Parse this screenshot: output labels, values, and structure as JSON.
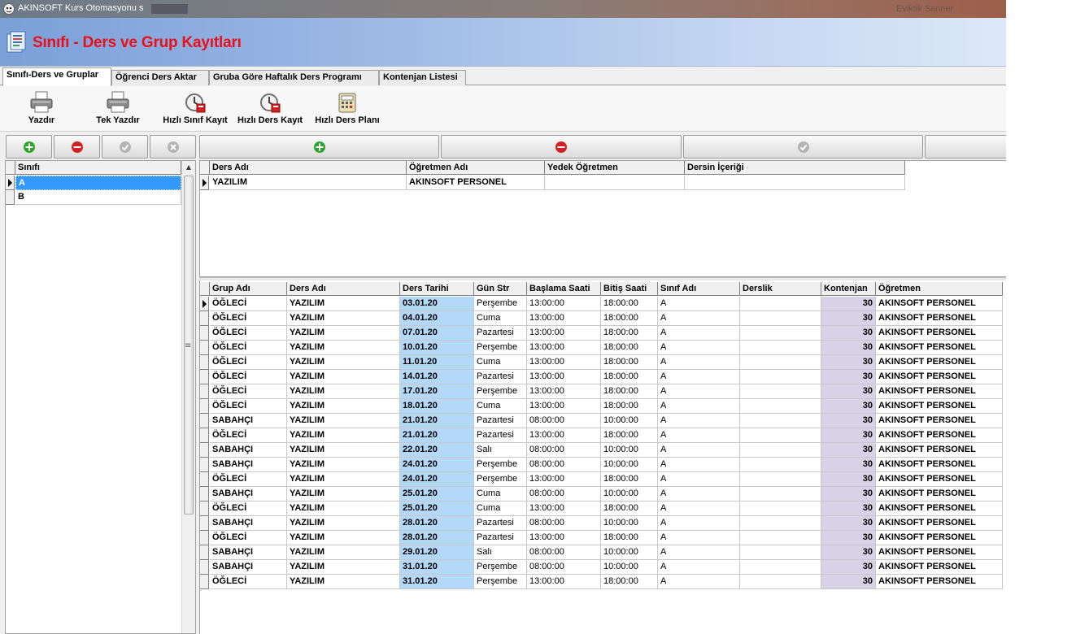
{
  "window": {
    "title": "AKINSOFT Kurs Otomasyonu s",
    "right_text": "Eviktik Sanner"
  },
  "header": {
    "title": "Sınıfı - Ders ve Grup Kayıtları"
  },
  "tabs": [
    {
      "label": "Sınıfı-Ders ve Gruplar",
      "active": true
    },
    {
      "label": "Öğrenci Ders Aktar"
    },
    {
      "label": "Gruba Göre Haftalık Ders Programı"
    },
    {
      "label": "Kontenjan Listesi"
    }
  ],
  "toolbar": {
    "print": "Yazdır",
    "single_print": "Tek Yazdır",
    "quick_class": "Hızlı Sınıf Kayıt",
    "quick_lesson": "Hızlı Ders Kayıt",
    "quick_plan": "Hızlı Ders Planı"
  },
  "classes": {
    "header": "Sınıfı",
    "rows": [
      "A",
      "B"
    ],
    "selected": "A"
  },
  "lessons": {
    "columns": [
      "Ders Adı",
      "Öğretmen Adı",
      "Yedek Öğretmen",
      "Dersin İçeriği"
    ],
    "rows": [
      [
        "YAZILIM",
        "AKINSOFT PERSONEL",
        "",
        ""
      ]
    ]
  },
  "groups": {
    "columns": [
      "Grup Adı",
      "Ders Adı",
      "Ders Tarihi",
      "Gün Str",
      "Başlama Saati",
      "Bitiş Saati",
      "Sınıf Adı",
      "Derslik",
      "Kontenjan",
      "Öğretmen"
    ],
    "rows": [
      [
        "ÖĞLECİ",
        "YAZILIM",
        "03.01.20",
        "Perşembe",
        "13:00:00",
        "18:00:00",
        "A",
        "",
        "30",
        "AKINSOFT PERSONEL"
      ],
      [
        "ÖĞLECİ",
        "YAZILIM",
        "04.01.20",
        "Cuma",
        "13:00:00",
        "18:00:00",
        "A",
        "",
        "30",
        "AKINSOFT PERSONEL"
      ],
      [
        "ÖĞLECİ",
        "YAZILIM",
        "07.01.20",
        "Pazartesi",
        "13:00:00",
        "18:00:00",
        "A",
        "",
        "30",
        "AKINSOFT PERSONEL"
      ],
      [
        "ÖĞLECİ",
        "YAZILIM",
        "10.01.20",
        "Perşembe",
        "13:00:00",
        "18:00:00",
        "A",
        "",
        "30",
        "AKINSOFT PERSONEL"
      ],
      [
        "ÖĞLECİ",
        "YAZILIM",
        "11.01.20",
        "Cuma",
        "13:00:00",
        "18:00:00",
        "A",
        "",
        "30",
        "AKINSOFT PERSONEL"
      ],
      [
        "ÖĞLECİ",
        "YAZILIM",
        "14.01.20",
        "Pazartesi",
        "13:00:00",
        "18:00:00",
        "A",
        "",
        "30",
        "AKINSOFT PERSONEL"
      ],
      [
        "ÖĞLECİ",
        "YAZILIM",
        "17.01.20",
        "Perşembe",
        "13:00:00",
        "18:00:00",
        "A",
        "",
        "30",
        "AKINSOFT PERSONEL"
      ],
      [
        "ÖĞLECİ",
        "YAZILIM",
        "18.01.20",
        "Cuma",
        "13:00:00",
        "18:00:00",
        "A",
        "",
        "30",
        "AKINSOFT PERSONEL"
      ],
      [
        "SABAHÇI",
        "YAZILIM",
        "21.01.20",
        "Pazartesi",
        "08:00:00",
        "10:00:00",
        "A",
        "",
        "30",
        "AKINSOFT PERSONEL"
      ],
      [
        "ÖĞLECİ",
        "YAZILIM",
        "21.01.20",
        "Pazartesi",
        "13:00:00",
        "18:00:00",
        "A",
        "",
        "30",
        "AKINSOFT PERSONEL"
      ],
      [
        "SABAHÇI",
        "YAZILIM",
        "22.01.20",
        "Salı",
        "08:00:00",
        "10:00:00",
        "A",
        "",
        "30",
        "AKINSOFT PERSONEL"
      ],
      [
        "SABAHÇI",
        "YAZILIM",
        "24.01.20",
        "Perşembe",
        "08:00:00",
        "10:00:00",
        "A",
        "",
        "30",
        "AKINSOFT PERSONEL"
      ],
      [
        "ÖĞLECİ",
        "YAZILIM",
        "24.01.20",
        "Perşembe",
        "13:00:00",
        "18:00:00",
        "A",
        "",
        "30",
        "AKINSOFT PERSONEL"
      ],
      [
        "SABAHÇI",
        "YAZILIM",
        "25.01.20",
        "Cuma",
        "08:00:00",
        "10:00:00",
        "A",
        "",
        "30",
        "AKINSOFT PERSONEL"
      ],
      [
        "ÖĞLECİ",
        "YAZILIM",
        "25.01.20",
        "Cuma",
        "13:00:00",
        "18:00:00",
        "A",
        "",
        "30",
        "AKINSOFT PERSONEL"
      ],
      [
        "SABAHÇI",
        "YAZILIM",
        "28.01.20",
        "Pazartesi",
        "08:00:00",
        "10:00:00",
        "A",
        "",
        "30",
        "AKINSOFT PERSONEL"
      ],
      [
        "ÖĞLECİ",
        "YAZILIM",
        "28.01.20",
        "Pazartesi",
        "13:00:00",
        "18:00:00",
        "A",
        "",
        "30",
        "AKINSOFT PERSONEL"
      ],
      [
        "SABAHÇI",
        "YAZILIM",
        "29.01.20",
        "Salı",
        "08:00:00",
        "10:00:00",
        "A",
        "",
        "30",
        "AKINSOFT PERSONEL"
      ],
      [
        "SABAHÇI",
        "YAZILIM",
        "31.01.20",
        "Perşembe",
        "08:00:00",
        "10:00:00",
        "A",
        "",
        "30",
        "AKINSOFT PERSONEL"
      ],
      [
        "ÖĞLECİ",
        "YAZILIM",
        "31.01.20",
        "Perşembe",
        "13:00:00",
        "18:00:00",
        "A",
        "",
        "30",
        "AKINSOFT PERSONEL"
      ]
    ]
  },
  "colors": {
    "title_red": "#e8101a",
    "date_column_bg": "#b4d8f8",
    "quota_column_bg": "#d8d2e6",
    "selection_bg": "#3399ff",
    "add_green": "#2ea42e",
    "remove_red": "#d42020"
  },
  "icons": [
    "printer-icon",
    "quick-class-icon",
    "quick-lesson-icon",
    "calculator-plan-icon",
    "add-icon",
    "remove-icon",
    "confirm-icon",
    "cancel-icon"
  ]
}
